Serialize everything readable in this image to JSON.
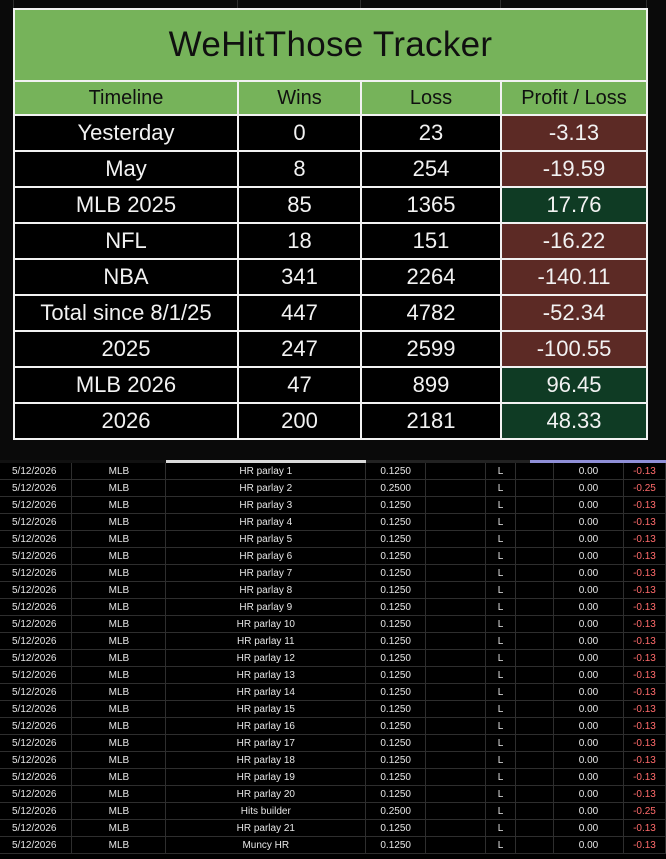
{
  "title": "WeHitThose Tracker",
  "headers": [
    "Timeline",
    "Wins",
    "Loss",
    "Profit / Loss"
  ],
  "summary_rows": [
    {
      "timeline": "Yesterday",
      "wins": "0",
      "loss": "23",
      "pl": "-3.13",
      "sign": "neg"
    },
    {
      "timeline": "May",
      "wins": "8",
      "loss": "254",
      "pl": "-19.59",
      "sign": "neg"
    },
    {
      "timeline": "MLB 2025",
      "wins": "85",
      "loss": "1365",
      "pl": "17.76",
      "sign": "pos"
    },
    {
      "timeline": "NFL",
      "wins": "18",
      "loss": "151",
      "pl": "-16.22",
      "sign": "neg"
    },
    {
      "timeline": "NBA",
      "wins": "341",
      "loss": "2264",
      "pl": "-140.11",
      "sign": "neg"
    },
    {
      "timeline": "Total since 8/1/25",
      "wins": "447",
      "loss": "4782",
      "pl": "-52.34",
      "sign": "neg"
    },
    {
      "timeline": "2025",
      "wins": "247",
      "loss": "2599",
      "pl": "-100.55",
      "sign": "neg"
    },
    {
      "timeline": "MLB 2026",
      "wins": "47",
      "loss": "899",
      "pl": "96.45",
      "sign": "pos"
    },
    {
      "timeline": "2026",
      "wins": "200",
      "loss": "2181",
      "pl": "48.33",
      "sign": "pos"
    }
  ],
  "colors": {
    "header_green": "#76b35a",
    "loss_red": "#5c2a25",
    "profit_green": "#0f3b24",
    "negative_text": "#ff6b6b"
  },
  "bet_rows": [
    {
      "date": "5/12/2026",
      "league": "MLB",
      "bet": "HR parlay 1",
      "stake": "0.1250",
      "result": "L",
      "payout": "0.00",
      "pl": "-0.13"
    },
    {
      "date": "5/12/2026",
      "league": "MLB",
      "bet": "HR parlay 2",
      "stake": "0.2500",
      "result": "L",
      "payout": "0.00",
      "pl": "-0.25"
    },
    {
      "date": "5/12/2026",
      "league": "MLB",
      "bet": "HR parlay 3",
      "stake": "0.1250",
      "result": "L",
      "payout": "0.00",
      "pl": "-0.13"
    },
    {
      "date": "5/12/2026",
      "league": "MLB",
      "bet": "HR parlay 4",
      "stake": "0.1250",
      "result": "L",
      "payout": "0.00",
      "pl": "-0.13"
    },
    {
      "date": "5/12/2026",
      "league": "MLB",
      "bet": "HR parlay 5",
      "stake": "0.1250",
      "result": "L",
      "payout": "0.00",
      "pl": "-0.13"
    },
    {
      "date": "5/12/2026",
      "league": "MLB",
      "bet": "HR parlay 6",
      "stake": "0.1250",
      "result": "L",
      "payout": "0.00",
      "pl": "-0.13"
    },
    {
      "date": "5/12/2026",
      "league": "MLB",
      "bet": "HR parlay 7",
      "stake": "0.1250",
      "result": "L",
      "payout": "0.00",
      "pl": "-0.13"
    },
    {
      "date": "5/12/2026",
      "league": "MLB",
      "bet": "HR parlay 8",
      "stake": "0.1250",
      "result": "L",
      "payout": "0.00",
      "pl": "-0.13"
    },
    {
      "date": "5/12/2026",
      "league": "MLB",
      "bet": "HR parlay 9",
      "stake": "0.1250",
      "result": "L",
      "payout": "0.00",
      "pl": "-0.13"
    },
    {
      "date": "5/12/2026",
      "league": "MLB",
      "bet": "HR parlay 10",
      "stake": "0.1250",
      "result": "L",
      "payout": "0.00",
      "pl": "-0.13"
    },
    {
      "date": "5/12/2026",
      "league": "MLB",
      "bet": "HR parlay 11",
      "stake": "0.1250",
      "result": "L",
      "payout": "0.00",
      "pl": "-0.13"
    },
    {
      "date": "5/12/2026",
      "league": "MLB",
      "bet": "HR parlay 12",
      "stake": "0.1250",
      "result": "L",
      "payout": "0.00",
      "pl": "-0.13"
    },
    {
      "date": "5/12/2026",
      "league": "MLB",
      "bet": "HR parlay 13",
      "stake": "0.1250",
      "result": "L",
      "payout": "0.00",
      "pl": "-0.13"
    },
    {
      "date": "5/12/2026",
      "league": "MLB",
      "bet": "HR parlay 14",
      "stake": "0.1250",
      "result": "L",
      "payout": "0.00",
      "pl": "-0.13"
    },
    {
      "date": "5/12/2026",
      "league": "MLB",
      "bet": "HR parlay 15",
      "stake": "0.1250",
      "result": "L",
      "payout": "0.00",
      "pl": "-0.13"
    },
    {
      "date": "5/12/2026",
      "league": "MLB",
      "bet": "HR parlay 16",
      "stake": "0.1250",
      "result": "L",
      "payout": "0.00",
      "pl": "-0.13"
    },
    {
      "date": "5/12/2026",
      "league": "MLB",
      "bet": "HR parlay 17",
      "stake": "0.1250",
      "result": "L",
      "payout": "0.00",
      "pl": "-0.13"
    },
    {
      "date": "5/12/2026",
      "league": "MLB",
      "bet": "HR parlay 18",
      "stake": "0.1250",
      "result": "L",
      "payout": "0.00",
      "pl": "-0.13"
    },
    {
      "date": "5/12/2026",
      "league": "MLB",
      "bet": "HR parlay 19",
      "stake": "0.1250",
      "result": "L",
      "payout": "0.00",
      "pl": "-0.13"
    },
    {
      "date": "5/12/2026",
      "league": "MLB",
      "bet": "HR parlay 20",
      "stake": "0.1250",
      "result": "L",
      "payout": "0.00",
      "pl": "-0.13"
    },
    {
      "date": "5/12/2026",
      "league": "MLB",
      "bet": "Hits builder",
      "stake": "0.2500",
      "result": "L",
      "payout": "0.00",
      "pl": "-0.25"
    },
    {
      "date": "5/12/2026",
      "league": "MLB",
      "bet": "HR parlay 21",
      "stake": "0.1250",
      "result": "L",
      "payout": "0.00",
      "pl": "-0.13"
    },
    {
      "date": "5/12/2026",
      "league": "MLB",
      "bet": "Muncy HR",
      "stake": "0.1250",
      "result": "L",
      "payout": "0.00",
      "pl": "-0.13"
    }
  ]
}
